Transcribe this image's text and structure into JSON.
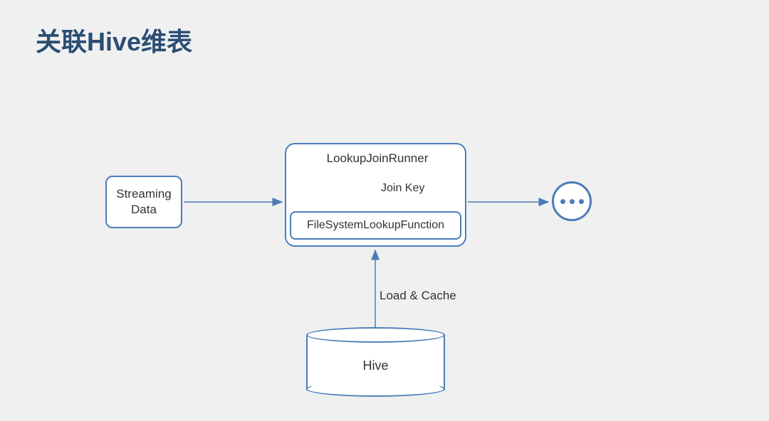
{
  "title": "关联Hive维表",
  "nodes": {
    "streaming": "Streaming\nData",
    "runner": "LookupJoinRunner",
    "lookupFn": "FileSystemLookupFunction",
    "hive": "Hive"
  },
  "edges": {
    "joinKey": "Join Key",
    "loadCache": "Load & Cache"
  },
  "colors": {
    "stroke": "#4a7db8",
    "title": "#2a4d73"
  }
}
